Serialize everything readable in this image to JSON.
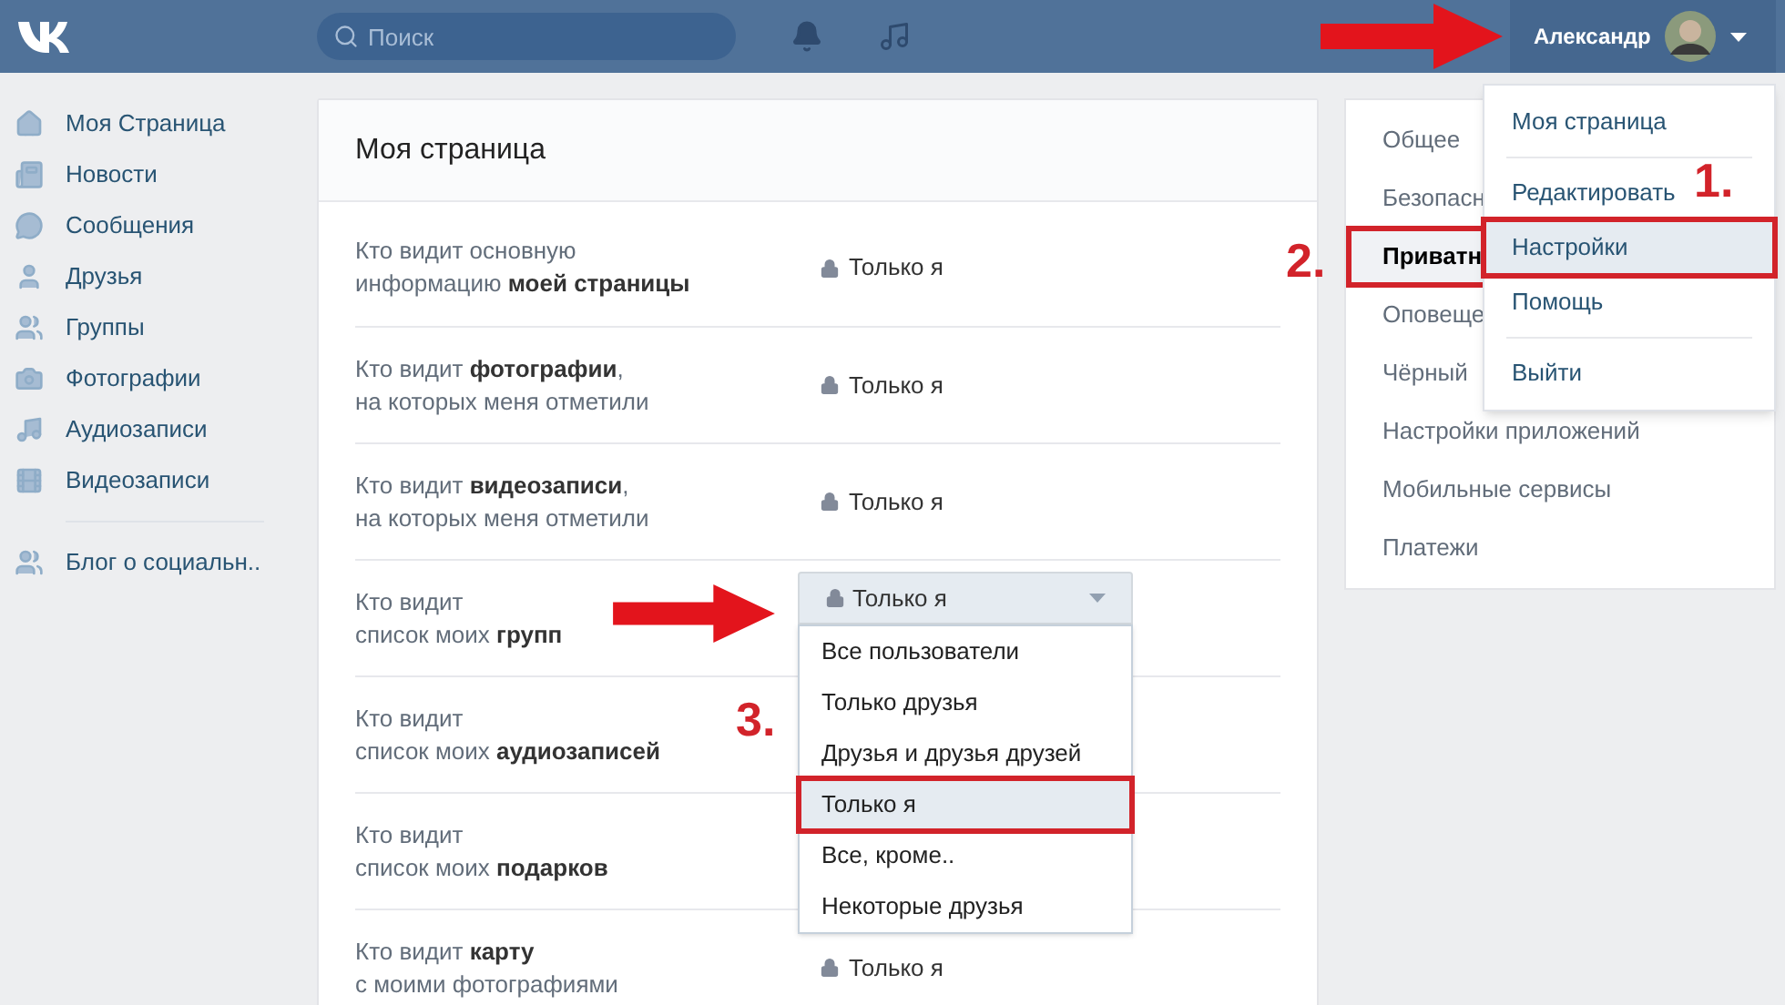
{
  "header": {
    "search": {
      "placeholder": "Поиск"
    },
    "user": {
      "name": "Александр"
    }
  },
  "sidebar": {
    "items": [
      {
        "label": "Моя Страница"
      },
      {
        "label": "Новости"
      },
      {
        "label": "Сообщения"
      },
      {
        "label": "Друзья"
      },
      {
        "label": "Группы"
      },
      {
        "label": "Фотографии"
      },
      {
        "label": "Аудиозаписи"
      },
      {
        "label": "Видеозаписи"
      }
    ],
    "extra_items": [
      {
        "label": "Блог о социальн.."
      }
    ]
  },
  "privacy": {
    "title": "Моя страница",
    "rows": [
      {
        "question": [
          "Кто видит основную",
          "информацию **моей страницы**"
        ],
        "value": "Только я"
      },
      {
        "question": [
          "Кто видит **фотографии**,",
          "на которых меня отметили"
        ],
        "value": "Только я"
      },
      {
        "question": [
          "Кто видит **видеозаписи**,",
          "на которых меня отметили"
        ],
        "value": "Только я"
      },
      {
        "question": [
          "Кто видит",
          "список моих **групп**"
        ],
        "value": "Только я",
        "expanded": true,
        "options": [
          {
            "label": "Все пользователи",
            "selected": false
          },
          {
            "label": "Только друзья",
            "selected": false
          },
          {
            "label": "Друзья и друзья друзей",
            "selected": false
          },
          {
            "label": "Только я",
            "selected": true
          },
          {
            "label": "Все, кроме..",
            "selected": false
          },
          {
            "label": "Некоторые друзья",
            "selected": false
          }
        ]
      },
      {
        "question": [
          "Кто видит",
          "список моих **аудиозаписей**"
        ]
      },
      {
        "question": [
          "Кто видит",
          "список моих **подарков**"
        ]
      },
      {
        "question": [
          "Кто видит **карту**",
          "с моими фотографиями"
        ],
        "value": "Только я"
      }
    ]
  },
  "settings_menu": {
    "items": [
      {
        "label": "Общее",
        "selected": false
      },
      {
        "label": "Безопасн",
        "selected": false
      },
      {
        "label": "Приватн",
        "selected": true
      },
      {
        "label": "Оповеще",
        "selected": false
      },
      {
        "label": "Чёрный",
        "selected": false
      },
      {
        "label": "Настройки приложений",
        "selected": false
      },
      {
        "label": "Мобильные сервисы",
        "selected": false
      },
      {
        "label": "Платежи",
        "selected": false
      }
    ]
  },
  "profile_menu": {
    "groups": [
      [
        {
          "label": "Моя страница",
          "selected": false
        }
      ],
      [
        {
          "label": "Редактировать",
          "selected": false
        },
        {
          "label": "Настройки",
          "selected": true
        },
        {
          "label": "Помощь",
          "selected": false
        }
      ],
      [
        {
          "label": "Выйти",
          "selected": false
        }
      ]
    ]
  },
  "annotations": {
    "steps": [
      "1.",
      "2.",
      "3."
    ]
  }
}
